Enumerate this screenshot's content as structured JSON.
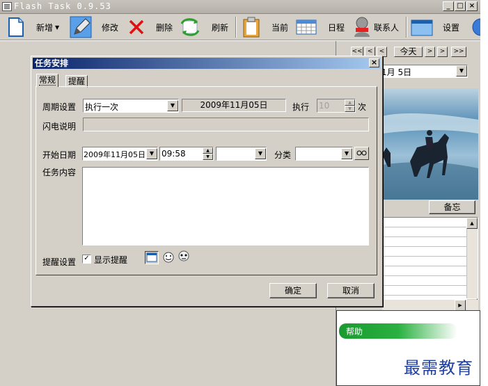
{
  "window": {
    "title": "Flash Task 0.9.53",
    "min": "_",
    "max": "□",
    "close": "×"
  },
  "toolbar": {
    "new_label": "新增",
    "edit_label": "修改",
    "delete_label": "删除",
    "refresh_label": "刷新",
    "current_label": "当前",
    "schedule_label": "日程",
    "contacts_label": "联系人",
    "settings_label": "设置"
  },
  "calendar": {
    "nav_first": "<<",
    "nav_prev": "<",
    "today": "今天",
    "nav_next": ">",
    "nav_last": ">>",
    "date_value": "1月 5日",
    "memo_button": "备忘"
  },
  "help_label": "帮助",
  "watermark": "最需教育",
  "dialog": {
    "title": "任务安排",
    "tabs": [
      "常规",
      "提醒"
    ],
    "period_label": "周期设置",
    "period_value": "执行一次",
    "period_date": "2009年11月05日",
    "exec_label": "执行",
    "exec_value": "10",
    "times_label": "次",
    "flash_label": "闪电说明",
    "flash_value": "",
    "start_label": "开始日期",
    "start_date": "2009年11月05日",
    "start_time": "09:58",
    "extra_value": "",
    "category_label": "分类",
    "category_value": "",
    "content_label": "任务内容",
    "content_value": "",
    "remind_label": "提醒设置",
    "show_remind_label": "显示提醒",
    "show_remind_checked": "✓",
    "ok_label": "确定",
    "cancel_label": "取消"
  }
}
